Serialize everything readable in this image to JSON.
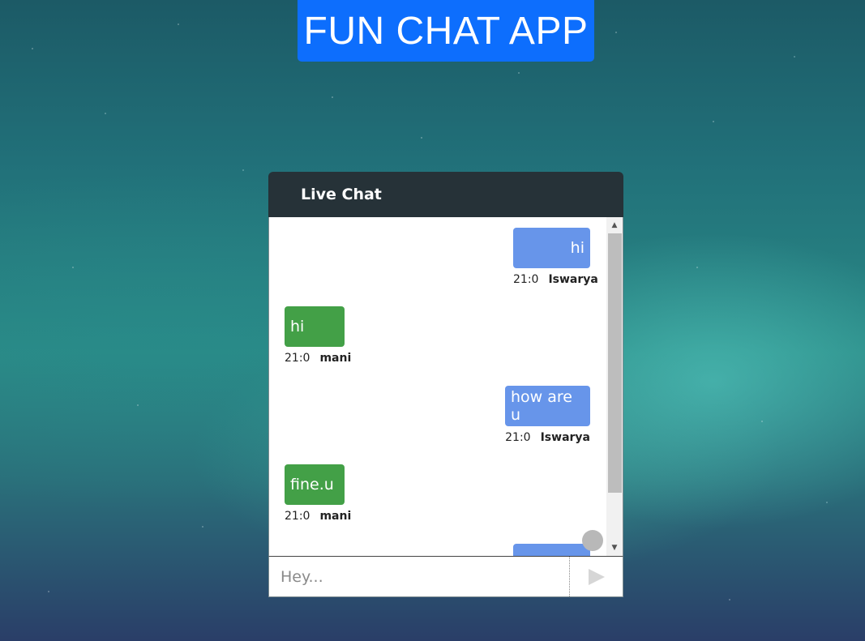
{
  "app": {
    "title": "FUN CHAT APP"
  },
  "chat": {
    "header_title": "Live Chat",
    "messages": [
      {
        "direction": "sent",
        "text": "hi",
        "time": "21:0",
        "user": "Iswarya"
      },
      {
        "direction": "received",
        "text": "hi",
        "time": "21:0",
        "user": "mani"
      },
      {
        "direction": "sent",
        "text": "how are u",
        "time": "21:0",
        "user": "Iswarya"
      },
      {
        "direction": "received",
        "text": "fine.u",
        "time": "21:0",
        "user": "mani"
      },
      {
        "direction": "sent",
        "text": "",
        "time": "",
        "user": ""
      }
    ],
    "input": {
      "placeholder": "Hey...",
      "value": ""
    },
    "send_icon": "send-triangle-icon"
  },
  "colors": {
    "title_bg": "#0d6efd",
    "header_bg": "#263238",
    "sent_bubble": "#6795ea",
    "received_bubble": "#43a047"
  }
}
